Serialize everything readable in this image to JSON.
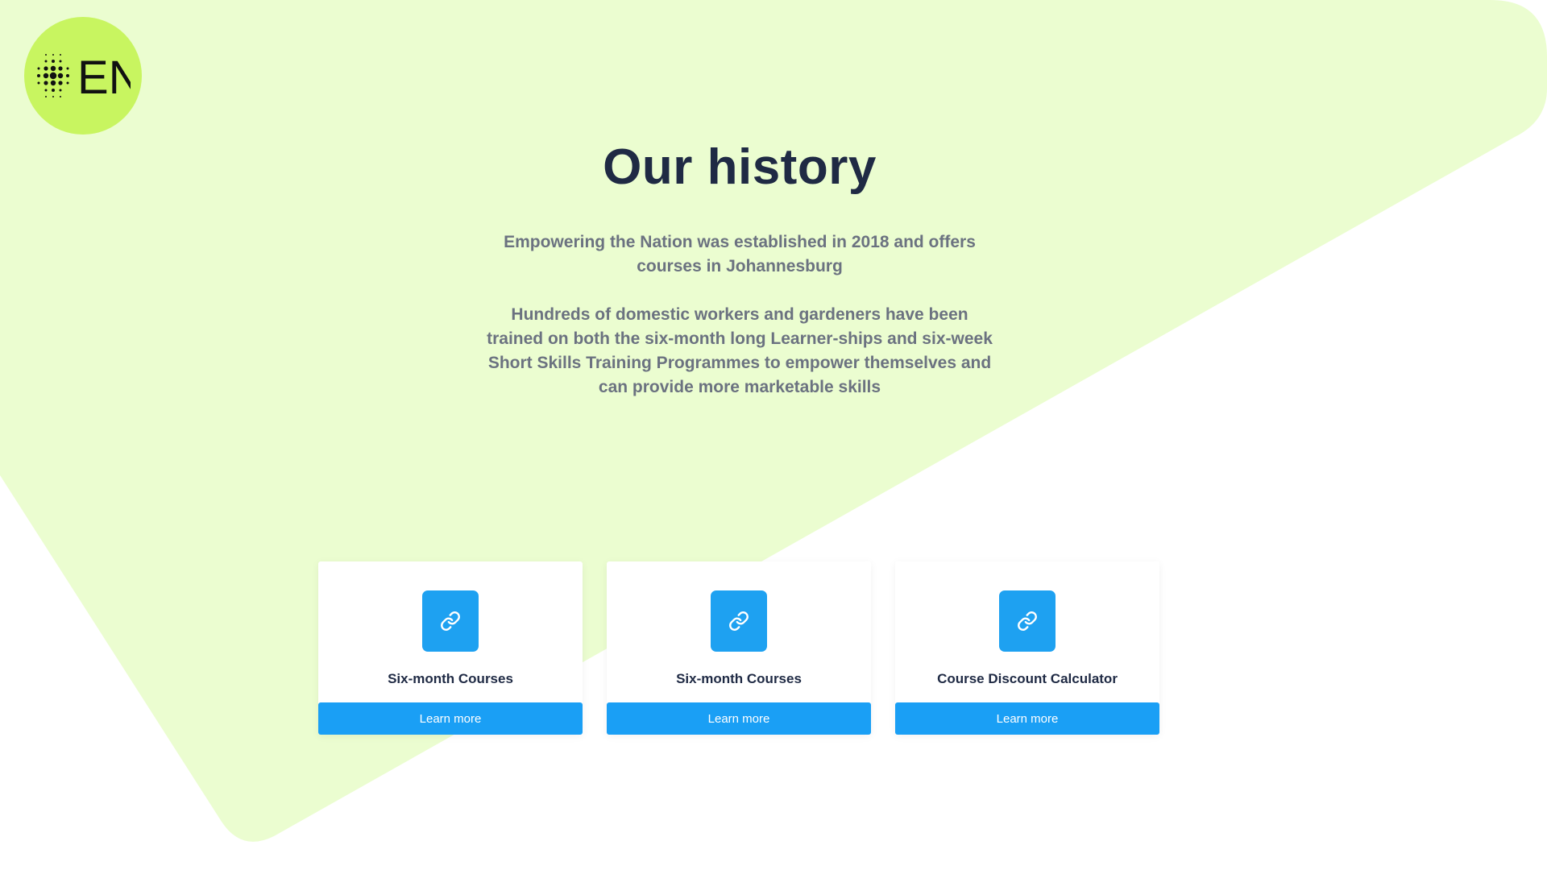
{
  "logo": {
    "text": "EN",
    "icon": "dots-grid-icon",
    "color": "#c8f560"
  },
  "theme": {
    "background_shape": "#ebfdd0",
    "accent": "#1a9ff5",
    "title_color": "#1f2a44",
    "text_color": "#6b7280"
  },
  "main": {
    "title": "Our history",
    "paragraph_1": "Empowering the Nation was established in 2018 and offers courses in Johannesburg",
    "paragraph_2": "Hundreds of domestic workers and gardeners have been trained on both the six-month long Learner-ships and six-week Short Skills Training Programmes to empower themselves and can provide more marketable skills"
  },
  "cards": [
    {
      "icon": "link-icon",
      "title": "Six-month Courses",
      "button": "Learn more"
    },
    {
      "icon": "link-icon",
      "title": "Six-month Courses",
      "button": "Learn more"
    },
    {
      "icon": "link-icon",
      "title": "Course Discount Calculator",
      "button": "Learn more"
    }
  ]
}
